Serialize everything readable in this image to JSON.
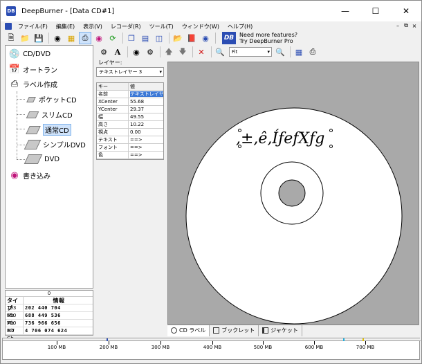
{
  "window": {
    "title": "DeepBurner - [Data CD#1]",
    "app_icon": "DB",
    "controls": [
      "minimize",
      "maximize",
      "close"
    ]
  },
  "menu": {
    "items": [
      "ファイル(F)",
      "編集(E)",
      "表示(V)",
      "レコーダ(R)",
      "ツール(T)",
      "ウィンドウ(W)",
      "ヘルプ(H)"
    ]
  },
  "ad": {
    "logo": "DB",
    "line1": "Need more features?",
    "line2": "Try DeepBurner Pro"
  },
  "nav": {
    "cddvd": "CD/DVD",
    "autorun": "オートラン",
    "label": "ラベル作成",
    "pocket": "ポケットCD",
    "slim": "スリムCD",
    "normal": "通常CD",
    "simple_dvd": "シンプルDVD",
    "dvd": "DVD",
    "burn": "書き込み"
  },
  "capacity": {
    "top": "0",
    "header": {
      "type": "タイプ",
      "info": "情報"
    },
    "rows": [
      {
        "type": "193 Mb",
        "info": "202 440 704"
      },
      {
        "type": "650 Mb",
        "info": "688 449 536"
      },
      {
        "type": "700 Mb",
        "info": "736 966 656"
      },
      {
        "type": "4.7 Gb",
        "info": "4 706 074 624"
      }
    ]
  },
  "layer": {
    "label": "レイヤー:",
    "selected": "テキストレイヤー 3",
    "table_header": {
      "key": "キー",
      "value": "値"
    },
    "props": [
      {
        "key": "名前",
        "value": "テキストレイヤー 3"
      },
      {
        "key": "XCenter",
        "value": "55.68"
      },
      {
        "key": "YCenter",
        "value": "29.37"
      },
      {
        "key": "幅",
        "value": "49.55"
      },
      {
        "key": "高さ",
        "value": "10.22"
      },
      {
        "key": "視点",
        "value": "0.00"
      },
      {
        "key": "テキスト",
        "value": "==>"
      },
      {
        "key": "フォント",
        "value": "==>"
      },
      {
        "key": "色",
        "value": "==>"
      }
    ]
  },
  "canvas": {
    "zoom": "Fit",
    "label_text": ",±,ê,ÍƒefXƒg"
  },
  "tabs": {
    "cd_label": "CD ラベル",
    "booklet": "ブックレット",
    "jacket": "ジャケット"
  },
  "ruler": {
    "labels": [
      "100 MB",
      "200 MB",
      "300 MB",
      "400 MB",
      "500 MB",
      "600 MB",
      "700 MB"
    ]
  }
}
